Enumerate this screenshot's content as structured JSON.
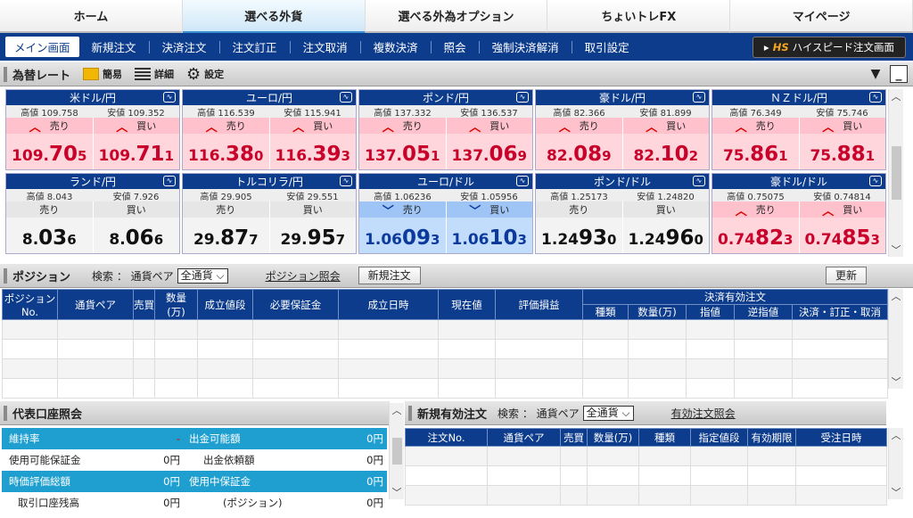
{
  "top_tabs": [
    "ホーム",
    "選べる外貨",
    "選べる外為オプション",
    "ちょいトレFX",
    "マイページ"
  ],
  "sub_nav": [
    "メイン画面",
    "新規注文",
    "決済注文",
    "注文訂正",
    "注文取消",
    "複数決済",
    "照会",
    "強制決済解消",
    "取引設定"
  ],
  "highspeed_button": {
    "logo": "HS",
    "label": "ハイスピード注文画面"
  },
  "rates_panel": {
    "title": "為替レート",
    "simple": "簡易",
    "detail": "詳細",
    "settings": "設定"
  },
  "rates": [
    {
      "pair": "米ドル/円",
      "high": "高値 109.758",
      "low": "安値 109.352",
      "trend": "up",
      "sell_label": "売り",
      "buy_label": "買い",
      "sell": [
        "109.",
        "70",
        "5"
      ],
      "buy": [
        "109.",
        "71",
        "1"
      ]
    },
    {
      "pair": "ユーロ/円",
      "high": "高値 116.539",
      "low": "安値 115.941",
      "trend": "up",
      "sell_label": "売り",
      "buy_label": "買い",
      "sell": [
        "116.",
        "38",
        "0"
      ],
      "buy": [
        "116.",
        "39",
        "3"
      ]
    },
    {
      "pair": "ポンド/円",
      "high": "高値 137.332",
      "low": "安値 136.537",
      "trend": "up",
      "sell_label": "売り",
      "buy_label": "買い",
      "sell": [
        "137.",
        "05",
        "1"
      ],
      "buy": [
        "137.",
        "06",
        "9"
      ]
    },
    {
      "pair": "豪ドル/円",
      "high": "高値 82.366",
      "low": "安値 81.899",
      "trend": "up",
      "sell_label": "売り",
      "buy_label": "買い",
      "sell": [
        "82.",
        "08",
        "9"
      ],
      "buy": [
        "82.",
        "10",
        "2"
      ]
    },
    {
      "pair": "ＮＺドル/円",
      "high": "高値 76.349",
      "low": "安値 75.746",
      "trend": "up",
      "sell_label": "売り",
      "buy_label": "買い",
      "sell": [
        "75.",
        "86",
        "1"
      ],
      "buy": [
        "75.",
        "88",
        "1"
      ]
    },
    {
      "pair": "ランド/円",
      "high": "高値 8.043",
      "low": "安値 7.926",
      "trend": "flat",
      "sell_label": "売り",
      "buy_label": "買い",
      "sell": [
        "8.",
        "03",
        "6"
      ],
      "buy": [
        "8.",
        "06",
        "6"
      ]
    },
    {
      "pair": "トルコリラ/円",
      "high": "高値 29.905",
      "low": "安値 29.551",
      "trend": "flat",
      "sell_label": "売り",
      "buy_label": "買い",
      "sell": [
        "29.",
        "87",
        "7"
      ],
      "buy": [
        "29.",
        "95",
        "7"
      ]
    },
    {
      "pair": "ユーロ/ドル",
      "high": "高値 1.06236",
      "low": "安値 1.05956",
      "trend": "down",
      "sell_label": "売り",
      "buy_label": "買い",
      "sell": [
        "1.06",
        "09",
        "3"
      ],
      "buy": [
        "1.06",
        "10",
        "3"
      ]
    },
    {
      "pair": "ポンド/ドル",
      "high": "高値 1.25173",
      "low": "安値 1.24820",
      "trend": "flat",
      "sell_label": "売り",
      "buy_label": "買い",
      "sell": [
        "1.24",
        "93",
        "0"
      ],
      "buy": [
        "1.24",
        "96",
        "0"
      ]
    },
    {
      "pair": "豪ドル/ドル",
      "high": "高値 0.75075",
      "low": "安値 0.74814",
      "trend": "up",
      "sell_label": "売り",
      "buy_label": "買い",
      "sell": [
        "0.74",
        "82",
        "3"
      ],
      "buy": [
        "0.74",
        "85",
        "3"
      ]
    }
  ],
  "position_panel": {
    "title": "ポジション",
    "search_label": "検索 ： 通貨ペア",
    "currency_select": "全通貨",
    "inquiry_link": "ポジション照会",
    "new_order": "新規注文",
    "refresh": "更新"
  },
  "position_columns": [
    "ポジション No.",
    "通貨ペア",
    "売買",
    "数量 (万)",
    "成立値段",
    "必要保証金",
    "成立日時",
    "現在値",
    "評価損益"
  ],
  "settlement_group": "決済有効注文",
  "settlement_columns": [
    "種類",
    "数量(万)",
    "指値",
    "逆指値",
    "決済・訂正・取消"
  ],
  "account_panel": {
    "title": "代表口座照会"
  },
  "account_rows": [
    {
      "k1": "維持率",
      "v1": "-",
      "k2": "出金可能額",
      "v2": "0円"
    },
    {
      "k1": "使用可能保証金",
      "v1": "0円",
      "k2": "出金依頼額",
      "v2": "0円"
    },
    {
      "k1": "時価評価総額",
      "v1": "0円",
      "k2": "使用中保証金",
      "v2": "0円"
    },
    {
      "k1": "取引口座残高",
      "v1": "0円",
      "k2": "(ポジション)",
      "v2": "0円"
    }
  ],
  "neworder_panel": {
    "title": "新規有効注文",
    "search_label": "検索 ： 通貨ペア",
    "currency_select": "全通貨",
    "inquiry_link": "有効注文照会"
  },
  "neworder_columns": [
    "注文No.",
    "通貨ペア",
    "売買",
    "数量(万)",
    "種類",
    "指定値段",
    "有効期限",
    "受注日時"
  ]
}
